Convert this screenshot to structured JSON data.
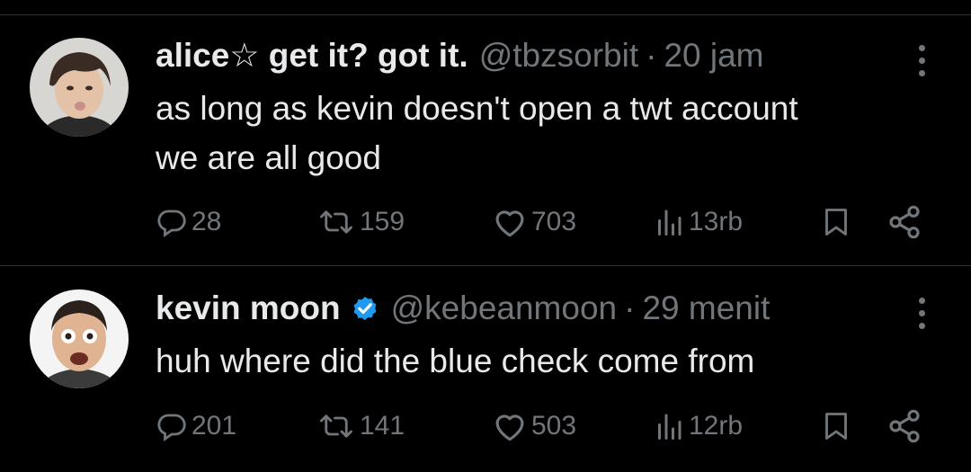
{
  "tweets": [
    {
      "display_name": "alice☆ get it? got it.",
      "handle": "@tbzsorbit",
      "separator": "·",
      "time": "20 jam",
      "verified": false,
      "text_lines": [
        "as long as kevin doesn't open a twt account",
        "we are all good"
      ],
      "replies": "28",
      "retweets": "159",
      "likes": "703",
      "views": "13rb",
      "avatar_icon": "user-avatar-photo"
    },
    {
      "display_name": "kevin moon",
      "handle": "@kebeanmoon",
      "separator": "·",
      "time": "29 menit",
      "verified": true,
      "text_lines": [
        "huh where did the blue check come from"
      ],
      "replies": "201",
      "retweets": "141",
      "likes": "503",
      "views": "12rb",
      "avatar_icon": "user-avatar-photo"
    }
  ],
  "colors": {
    "background": "#000000",
    "text": "#e7e9ea",
    "secondary": "#71767b",
    "divider": "#2f3336",
    "verified": "#1d9bf0"
  }
}
